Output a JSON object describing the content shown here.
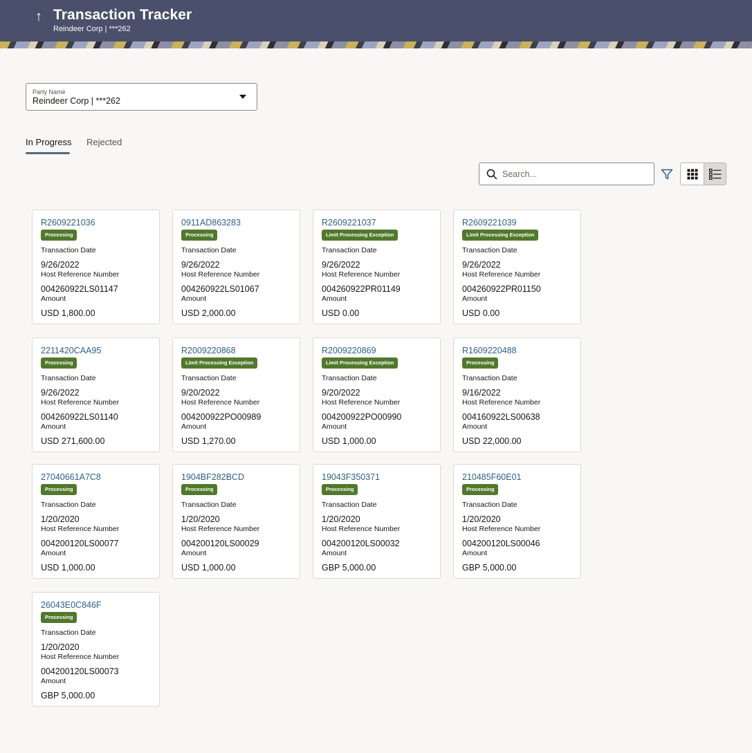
{
  "header": {
    "title": "Transaction Tracker",
    "subtitle": "Reindeer Corp | ***262"
  },
  "party_select": {
    "label": "Party Name",
    "value": "Reindeer Corp | ***262"
  },
  "tabs": [
    {
      "label": "In Progress",
      "active": true
    },
    {
      "label": "Rejected",
      "active": false
    }
  ],
  "search": {
    "placeholder": "Search..."
  },
  "card_labels": {
    "transaction_date": "Transaction Date",
    "host_reference": "Host Reference Number",
    "amount": "Amount"
  },
  "colors": {
    "header_bg": "#4a4f6b",
    "badge_green": "#51782c",
    "link_blue": "#2f5f86"
  },
  "transactions": [
    {
      "ref": "R2609221036",
      "status": "Processing",
      "date": "9/26/2022",
      "host_ref": "004260922LS01147",
      "amount": "USD 1,800.00"
    },
    {
      "ref": "0911AD863283",
      "status": "Processing",
      "date": "9/26/2022",
      "host_ref": "004260922LS01067",
      "amount": "USD 2,000.00"
    },
    {
      "ref": "R2609221037",
      "status": "Limit Processing Exception",
      "date": "9/26/2022",
      "host_ref": "004260922PR01149",
      "amount": "USD 0.00"
    },
    {
      "ref": "R2609221039",
      "status": "Limit Processing Exception",
      "date": "9/26/2022",
      "host_ref": "004260922PR01150",
      "amount": "USD 0.00"
    },
    {
      "ref": "2211420CAA95",
      "status": "Processing",
      "date": "9/26/2022",
      "host_ref": "004260922LS01140",
      "amount": "USD 271,600.00"
    },
    {
      "ref": "R2009220868",
      "status": "Limit Processing Exception",
      "date": "9/20/2022",
      "host_ref": "004200922PO00989",
      "amount": "USD 1,270.00"
    },
    {
      "ref": "R2009220869",
      "status": "Limit Processing Exception",
      "date": "9/20/2022",
      "host_ref": "004200922PO00990",
      "amount": "USD 1,000.00"
    },
    {
      "ref": "R1609220488",
      "status": "Processing",
      "date": "9/16/2022",
      "host_ref": "004160922LS00638",
      "amount": "USD 22,000.00"
    },
    {
      "ref": "27040661A7C8",
      "status": "Processing",
      "date": "1/20/2020",
      "host_ref": "004200120LS00077",
      "amount": "USD 1,000.00"
    },
    {
      "ref": "1904BF282BCD",
      "status": "Processing",
      "date": "1/20/2020",
      "host_ref": "004200120LS00029",
      "amount": "USD 1,000.00"
    },
    {
      "ref": "19043F350371",
      "status": "Processing",
      "date": "1/20/2020",
      "host_ref": "004200120LS00032",
      "amount": "GBP 5,000.00"
    },
    {
      "ref": "210485F60E01",
      "status": "Processing",
      "date": "1/20/2020",
      "host_ref": "004200120LS00046",
      "amount": "GBP 5,000.00"
    },
    {
      "ref": "26043E0C846F",
      "status": "Processing",
      "date": "1/20/2020",
      "host_ref": "004200120LS00073",
      "amount": "GBP 5,000.00"
    }
  ]
}
